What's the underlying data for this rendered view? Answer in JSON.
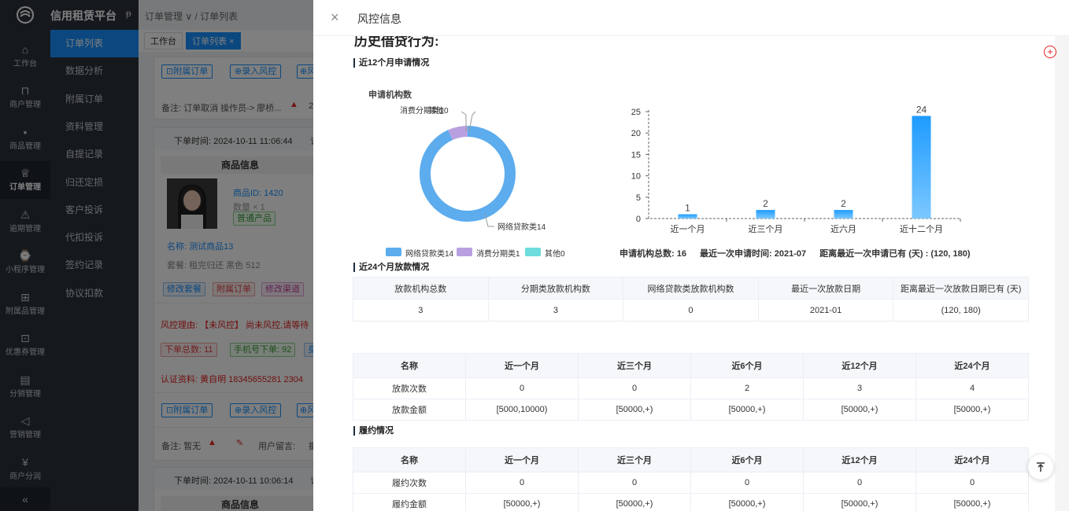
{
  "app": {
    "title": "信用租赁平台"
  },
  "rail": {
    "items": [
      {
        "label": "工作台",
        "icon": "home-icon"
      },
      {
        "label": "商户管理",
        "icon": "bag-icon"
      },
      {
        "label": "商品管理",
        "icon": "apple-icon"
      },
      {
        "label": "订单管理",
        "icon": "trophy-icon"
      },
      {
        "label": "逾期管理",
        "icon": "alarm-icon"
      },
      {
        "label": "小程序管理",
        "icon": "watch-icon"
      },
      {
        "label": "附属品管理",
        "icon": "box-icon"
      },
      {
        "label": "优惠券管理",
        "icon": "gift-icon"
      },
      {
        "label": "分销管理",
        "icon": "chart-icon"
      },
      {
        "label": "营销管理",
        "icon": "megaphone-icon"
      },
      {
        "label": "商户分润",
        "icon": "yen-icon"
      }
    ],
    "collapse": "«"
  },
  "submenu": {
    "items": [
      "订单列表",
      "数据分析",
      "附属订单",
      "资料管理",
      "自提记录",
      "归还定损",
      "客户投诉",
      "代扣投诉",
      "签约记录",
      "协议扣款"
    ]
  },
  "bg": {
    "breadcrumb": "订单管理 ∨ / 订单列表",
    "tabs": {
      "home": "工作台",
      "active": "订单列表"
    },
    "btn_attach": "附属订单",
    "btn_risk": "录入风控",
    "btn_third": "风",
    "remark1": "备注: 订单取消 操作员-> 廖桥...",
    "remark1_num": "2",
    "order_time1": "下单时间:  2024-10-11 11:06:44",
    "order_time1_suffix": "订",
    "goods_header": "商品信息",
    "product_id": "商品ID:  1420",
    "quantity": "数量 × 1",
    "product_tag": "普通产品",
    "product_name": "名称:  测试商品13",
    "package": "套餐:  租完归还 黑色 512",
    "actions": [
      "修改套餐",
      "附属订单",
      "修改渠道"
    ],
    "risk_reason": "风控理由:  【未风控】 尚未风控,请等待",
    "stats": [
      "下单总数:  11",
      "手机号下单:  92",
      "身"
    ],
    "auth": "认证资料:  黄自明   18345655281   2304",
    "remark2": "备注: 暂无",
    "user_msg": "用户留言:",
    "user_msg_suffix": "据",
    "order_time2": "下单时间:  2024-10-11 10:06:14",
    "order_time2_suffix": "订"
  },
  "drawer": {
    "title": "风控信息",
    "close": "×",
    "section_main": "历史借贷行为:",
    "section_12m": "近12个月申请情况",
    "section_24m": "近24个月放款情况",
    "section_perf": "履约情况",
    "stats": {
      "total": "申请机构总数:  16",
      "latest": "最近一次申请时间:  2021-07",
      "since": "距离最近一次申请已有 (天) :  (120, 180)"
    },
    "loan_table": {
      "headers": [
        "放款机构总数",
        "分期类放款机构数",
        "网络贷款类放款机构数",
        "最近一次放款日期",
        "距离最近一次放款日期已有 (天)"
      ],
      "row": [
        "3",
        "3",
        "0",
        "2021-01",
        "(120, 180)"
      ]
    },
    "loan_detail_table": {
      "headers": [
        "名称",
        "近一个月",
        "近三个月",
        "近6个月",
        "近12个月",
        "近24个月"
      ],
      "rows": [
        [
          "放款次数",
          "0",
          "0",
          "2",
          "3",
          "4"
        ],
        [
          "放款金额",
          "[5000,10000)",
          "[50000,+)",
          "[50000,+)",
          "[50000,+)",
          "[50000,+)"
        ]
      ]
    },
    "perf_table": {
      "headers": [
        "名称",
        "近一个月",
        "近三个月",
        "近6个月",
        "近12个月",
        "近24个月"
      ],
      "rows": [
        [
          "履约次数",
          "0",
          "0",
          "0",
          "0",
          "0"
        ],
        [
          "履约金额",
          "[50000,+)",
          "[50000,+)",
          "[50000,+)",
          "[50000,+)",
          "[50000,+)"
        ]
      ]
    },
    "scroll_top": "⊤"
  },
  "chart_data": [
    {
      "type": "pie",
      "title": "申请机构数",
      "donut": true,
      "slices": [
        {
          "name": "网络贷款类",
          "value": 14,
          "label": "网络贷款类14",
          "color": "#5cacee"
        },
        {
          "name": "消费分期类",
          "value": 1,
          "label": "消费分期类1",
          "color": "#b8a0e0"
        },
        {
          "name": "其他",
          "value": 0,
          "label": "其他0",
          "color": "#6cdcdc"
        }
      ],
      "callouts": [
        "消费分期类1",
        "其他0",
        "网络贷款类14"
      ],
      "legend": [
        "网络贷款类14",
        "消费分期类1",
        "其他0"
      ],
      "legend_placement": "bottom"
    },
    {
      "type": "bar",
      "categories": [
        "近一个月",
        "近三个月",
        "近六月",
        "近十二个月"
      ],
      "values": [
        1,
        2,
        2,
        24
      ],
      "ylim": [
        0,
        25
      ],
      "yticks": [
        0,
        5,
        10,
        15,
        20,
        25
      ],
      "color": "#1e9bff",
      "grid": false
    }
  ]
}
